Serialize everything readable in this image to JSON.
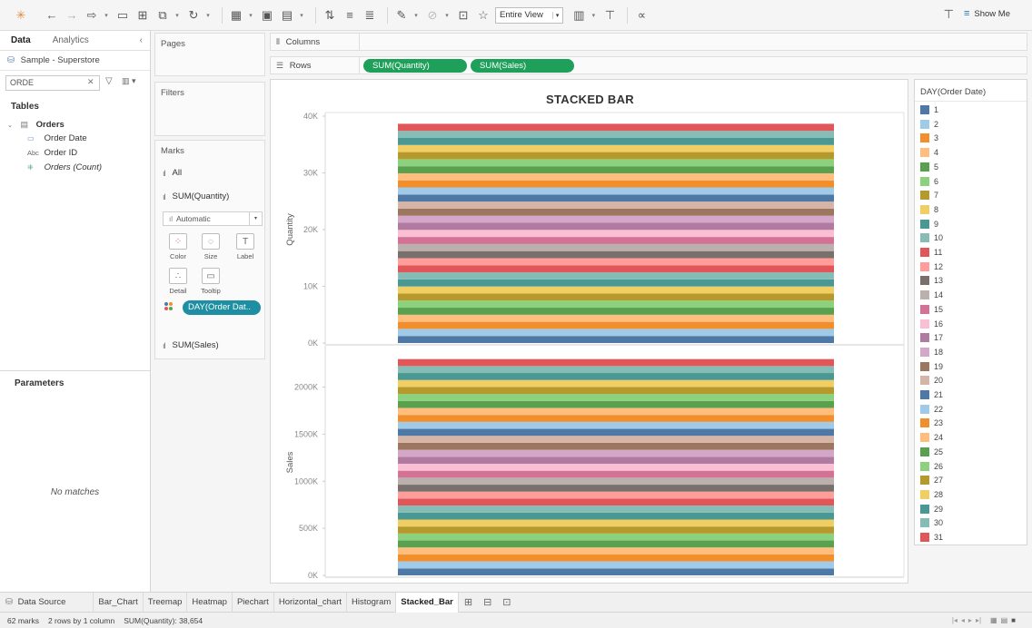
{
  "toolbar": {
    "fit_select": "Entire View",
    "show_me": "Show Me"
  },
  "left_pane": {
    "tabs": [
      "Data",
      "Analytics"
    ],
    "collapse_icon": "chevron-left-icon",
    "datasource": "Sample - Superstore",
    "search_value": "ORDE",
    "tables_heading": "Tables",
    "table_name": "Orders",
    "fields": [
      {
        "icon": "calendar-icon",
        "name": "Order Date"
      },
      {
        "icon": "abc-icon",
        "name": "Order ID"
      },
      {
        "icon": "measure-icon",
        "name": "Orders (Count)"
      }
    ],
    "parameters_heading": "Parameters",
    "no_matches": "No matches"
  },
  "cards": {
    "pages": "Pages",
    "filters": "Filters",
    "marks": "Marks",
    "marks_rows": [
      "All",
      "SUM(Quantity)",
      "SUM(Sales)"
    ],
    "mark_type": "Automatic",
    "buttons": [
      "Color",
      "Size",
      "Label",
      "Detail",
      "Tooltip"
    ],
    "color_pill": "DAY(Order Dat.."
  },
  "shelves": {
    "columns_label": "Columns",
    "rows_label": "Rows",
    "row_pills": [
      "SUM(Quantity)",
      "SUM(Sales)"
    ]
  },
  "chart_data": {
    "type": "bar",
    "title": "STACKED BAR",
    "stacked": true,
    "panes": [
      {
        "ylabel": "Quantity",
        "ylim": [
          0,
          40000
        ],
        "ticks": [
          0,
          10000,
          20000,
          30000,
          40000
        ],
        "tick_labels": [
          "0K",
          "10K",
          "20K",
          "30K",
          "40K"
        ],
        "total": 38654
      },
      {
        "ylabel": "Sales",
        "ylim": [
          0,
          2400000
        ],
        "ticks": [
          0,
          500000,
          1000000,
          1500000,
          2000000
        ],
        "tick_labels": [
          "0K",
          "500K",
          "1000K",
          "1500K",
          "2000K"
        ],
        "total": 2297200
      }
    ],
    "series_field": "DAY(Order Date)",
    "series": [
      "1",
      "2",
      "3",
      "4",
      "5",
      "6",
      "7",
      "8",
      "9",
      "10",
      "11",
      "12",
      "13",
      "14",
      "15",
      "16",
      "17",
      "18",
      "19",
      "20",
      "21",
      "22",
      "23",
      "24",
      "25",
      "26",
      "27",
      "28",
      "29",
      "30",
      "31"
    ],
    "colors": [
      "#4e79a7",
      "#a0cbe8",
      "#f28e2b",
      "#ffbe7d",
      "#59a14f",
      "#8cd17d",
      "#b6992d",
      "#f1ce63",
      "#499894",
      "#86bcb6",
      "#e15759",
      "#ff9d9a",
      "#79706e",
      "#bab0ac",
      "#d37295",
      "#fabfd2",
      "#b07aa1",
      "#d4a6c8",
      "#9d7660",
      "#d7b5a6",
      "#4e79a7",
      "#a0cbe8",
      "#f28e2b",
      "#ffbe7d",
      "#59a14f",
      "#8cd17d",
      "#b6992d",
      "#f1ce63",
      "#499894",
      "#86bcb6",
      "#e15759"
    ],
    "grid": false,
    "legend_position": "right"
  },
  "legend": {
    "title": "DAY(Order Date)"
  },
  "sheet_tabs": [
    "Data Source",
    "Bar_Chart",
    "Treemap",
    "Heatmap",
    "Piechart",
    "Horizontal_chart",
    "Histogram",
    "Stacked_Bar"
  ],
  "active_sheet": "Stacked_Bar",
  "status": {
    "marks": "62 marks",
    "rows_cols": "2 rows by 1 column",
    "sum": "SUM(Quantity): 38,654"
  }
}
